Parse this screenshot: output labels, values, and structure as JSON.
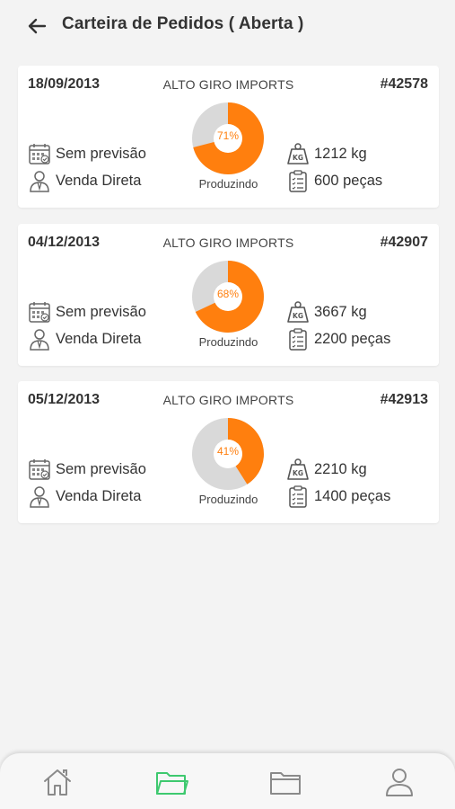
{
  "header": {
    "title": "Carteira de Pedidos ( Aberta )",
    "back_icon": "arrow-left-icon"
  },
  "orders": [
    {
      "date": "18/09/2013",
      "client": "ALTO GIRO IMPORTS",
      "number": "#42578",
      "progress_percent": 71,
      "progress_label": "71%",
      "status": "Produzindo",
      "forecast": "Sem previsão",
      "sale_type": "Venda Direta",
      "weight": "1212 kg",
      "pieces": "600 peças"
    },
    {
      "date": "04/12/2013",
      "client": "ALTO GIRO IMPORTS",
      "number": "#42907",
      "progress_percent": 68,
      "progress_label": "68%",
      "status": "Produzindo",
      "forecast": "Sem previsão",
      "sale_type": "Venda Direta",
      "weight": "3667 kg",
      "pieces": "2200 peças"
    },
    {
      "date": "05/12/2013",
      "client": "ALTO GIRO IMPORTS",
      "number": "#42913",
      "progress_percent": 41,
      "progress_label": "41%",
      "status": "Produzindo",
      "forecast": "Sem previsão",
      "sale_type": "Venda Direta",
      "weight": "2210 kg",
      "pieces": "1400 peças"
    }
  ],
  "bottom_nav": {
    "items": [
      {
        "icon": "home-icon",
        "active": false
      },
      {
        "icon": "folder-open-icon",
        "active": true
      },
      {
        "icon": "folder-icon",
        "active": false
      },
      {
        "icon": "user-icon",
        "active": false
      }
    ]
  },
  "colors": {
    "accent": "#ff7f0e",
    "donut_track": "#d9d9d9",
    "active_nav": "#3ec96f",
    "inactive_nav": "#8a8a8a",
    "background": "#f3f3f3"
  }
}
